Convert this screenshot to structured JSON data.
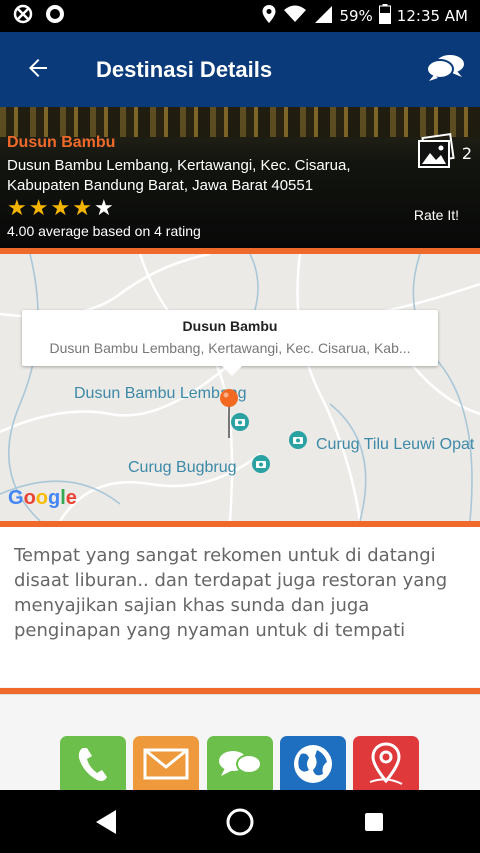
{
  "status_bar": {
    "battery": "59%",
    "time": "12:35 AM",
    "icons": [
      "blocked-icon",
      "record-icon",
      "location-icon",
      "wifi-icon",
      "signal-icon",
      "battery-icon"
    ]
  },
  "app_bar": {
    "title": "Destinasi Details",
    "icons": [
      "back-arrow-icon",
      "chat-bubbles-icon"
    ]
  },
  "place": {
    "name": "Dusun Bambu",
    "address_line1": "Dusun Bambu Lembang, Kertawangi, Kec. Cisarua,",
    "address_line2": "Kabupaten Bandung Barat, Jawa Barat 40551",
    "rating_stars": 4,
    "max_stars": 5,
    "rating_text": "4.00 average based on 4 rating",
    "photo_count": "2",
    "rate_label": "Rate It!"
  },
  "map": {
    "callout_title": "Dusun Bambu",
    "callout_subtitle": "Dusun Bambu Lembang, Kertawangi, Kec. Cisarua, Kab...",
    "labels": [
      "Dusun Bambu Lembang",
      "Curug Tilu Leuwi Opat",
      "Curug Bugbrug"
    ],
    "google_logo": "Google"
  },
  "description": "Tempat yang sangat rekomen untuk di datangi disaat liburan.. dan terdapat juga restoran yang menyajikan sajian khas sunda dan juga penginapan yang nyaman untuk di tempati",
  "actions": [
    {
      "name": "phone-icon",
      "color": "#6bbf4a"
    },
    {
      "name": "mail-icon",
      "color": "#ee9a3c"
    },
    {
      "name": "chat-icon",
      "color": "#6bbf4a"
    },
    {
      "name": "globe-icon",
      "color": "#1f6fc0"
    },
    {
      "name": "map-pin-icon",
      "color": "#e0393b"
    }
  ],
  "colors": {
    "app_bar": "#0b3a7a",
    "accent": "#ef6a2a",
    "star": "#f5b400"
  }
}
